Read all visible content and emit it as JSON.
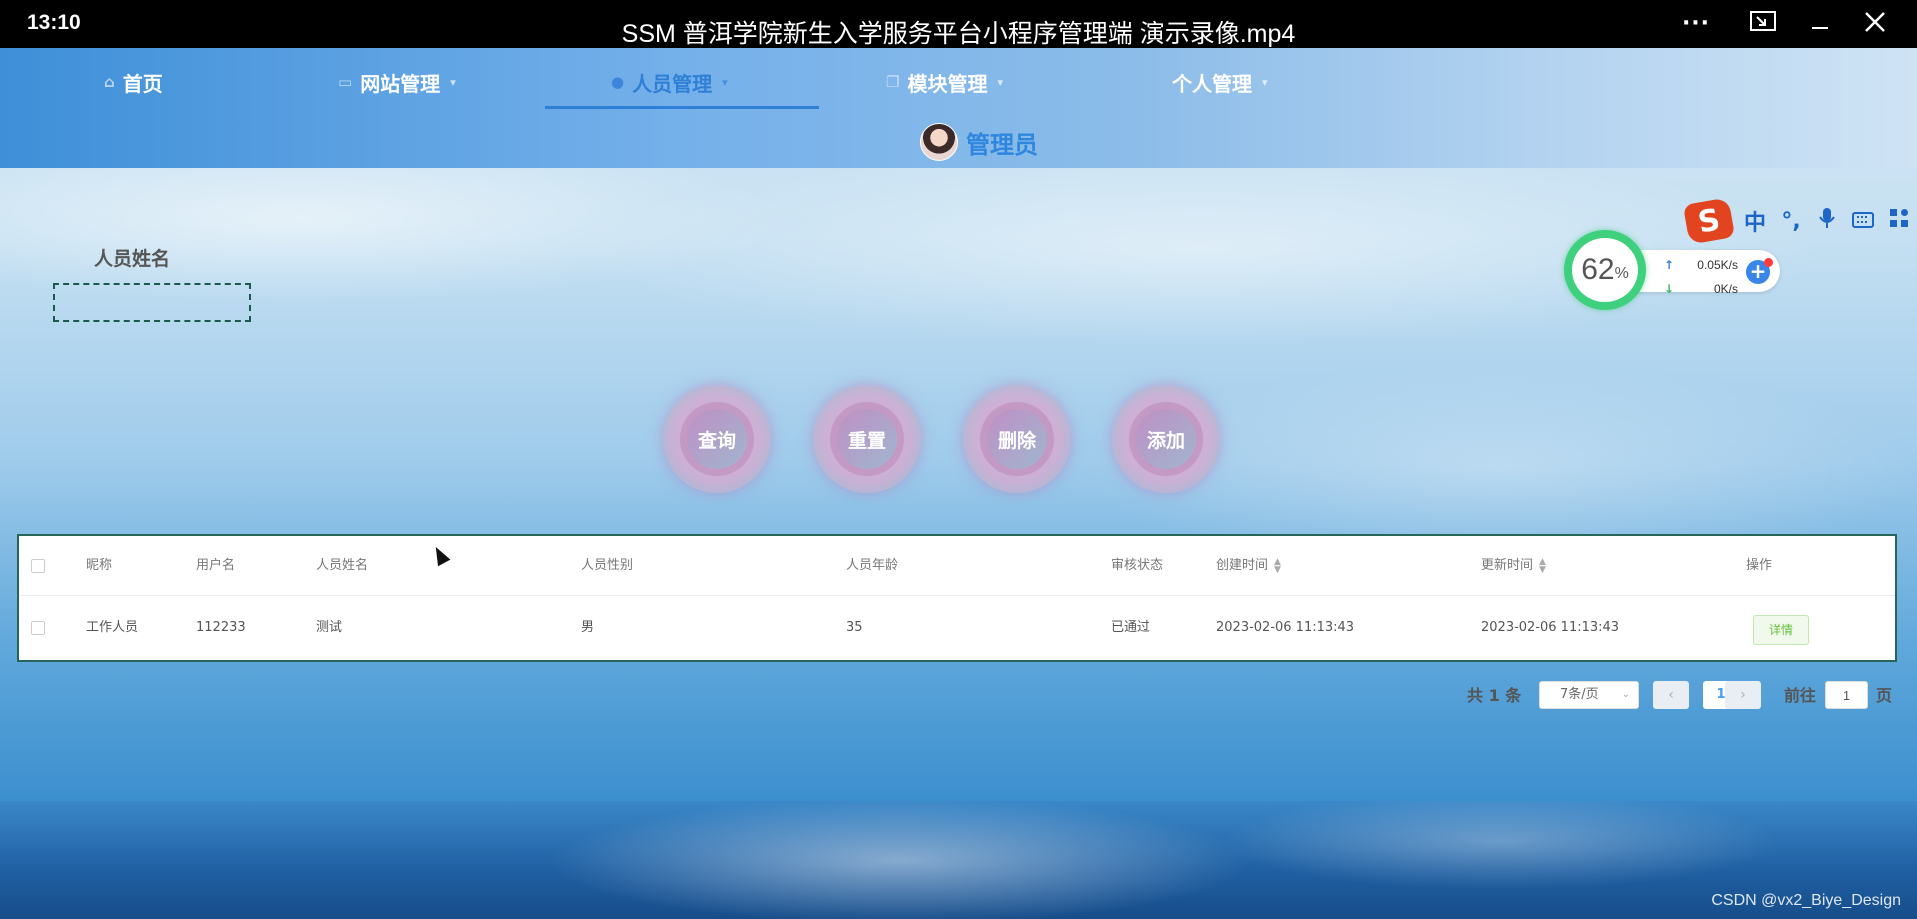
{
  "player": {
    "time": "13:10",
    "title": "SSM 普洱学院新生入学服务平台小程序管理端 演示录像.mp4"
  },
  "nav": {
    "items": [
      {
        "label": "首页",
        "icon": "home-icon"
      },
      {
        "label": "网站管理",
        "icon": "monitor-icon"
      },
      {
        "label": "人员管理",
        "icon": "user-icon"
      },
      {
        "label": "模块管理",
        "icon": "copy-icon"
      },
      {
        "label": "个人管理",
        "icon": ""
      }
    ],
    "active_index": 2
  },
  "user": {
    "name": "管理员"
  },
  "search": {
    "label": "人员姓名",
    "value": ""
  },
  "buttons": {
    "query": "查询",
    "reset": "重置",
    "delete": "删除",
    "add": "添加"
  },
  "table": {
    "headers": [
      "昵称",
      "用户名",
      "人员姓名",
      "人员性别",
      "人员年龄",
      "审核状态",
      "创建时间",
      "更新时间",
      "操作"
    ],
    "rows": [
      {
        "nickname": "工作人员",
        "username": "112233",
        "name": "测试",
        "gender": "男",
        "age": "35",
        "status": "已通过",
        "created": "2023-02-06 11:13:43",
        "updated": "2023-02-06 11:13:43",
        "action": "详情"
      }
    ]
  },
  "pagination": {
    "total_text": "共 1 条",
    "page_size": "7条/页",
    "current_page": "1",
    "goto_label": "前往",
    "goto_value": "1",
    "page_suffix": "页"
  },
  "overlay": {
    "ime": {
      "logo": "S",
      "mode": "中",
      "punct": "°,"
    },
    "speed": {
      "percent": "62",
      "pct_sign": "%",
      "up": "0.05K/s",
      "down": "0K/s"
    }
  },
  "watermark": "CSDN @vx2_Biye_Design",
  "colors": {
    "accent": "#2f7fd6",
    "table_border": "#26665a",
    "success": "#67c23a"
  }
}
